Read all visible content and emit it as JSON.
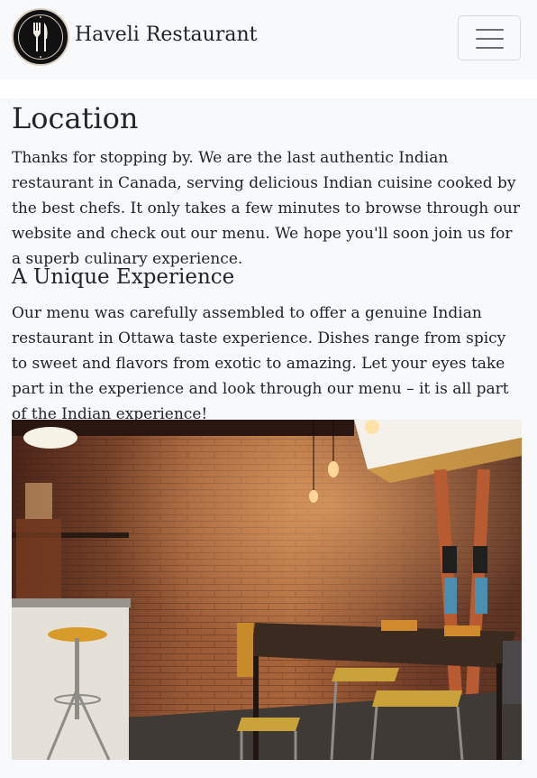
{
  "navbar": {
    "brand": "Haveli Restaurant",
    "logo_icon": "fork-knife-icon",
    "toggler_icon": "hamburger-menu-icon"
  },
  "content": {
    "title": "Location",
    "intro": "Thanks for stopping by. We are the last authentic Indian restaurant in Canada, serving delicious Indian cuisine cooked by the best chefs. It only takes a few minutes to browse through our website and check out our menu. We hope you'll soon join us for a superb culinary experience.",
    "subtitle": "A Unique Experience",
    "body": "Our menu was carefully assembled to offer a genuine Indian restaurant in Ottawa taste experience. Dishes range from spicy to sweet and flavors from exotic to amazing. Let your eyes take part in the experience and look through our menu – it is all part of the Indian experience!"
  },
  "colors": {
    "navbar_bg": "#f8f9fa",
    "text": "#212529",
    "brick": "#8a4a2e"
  }
}
